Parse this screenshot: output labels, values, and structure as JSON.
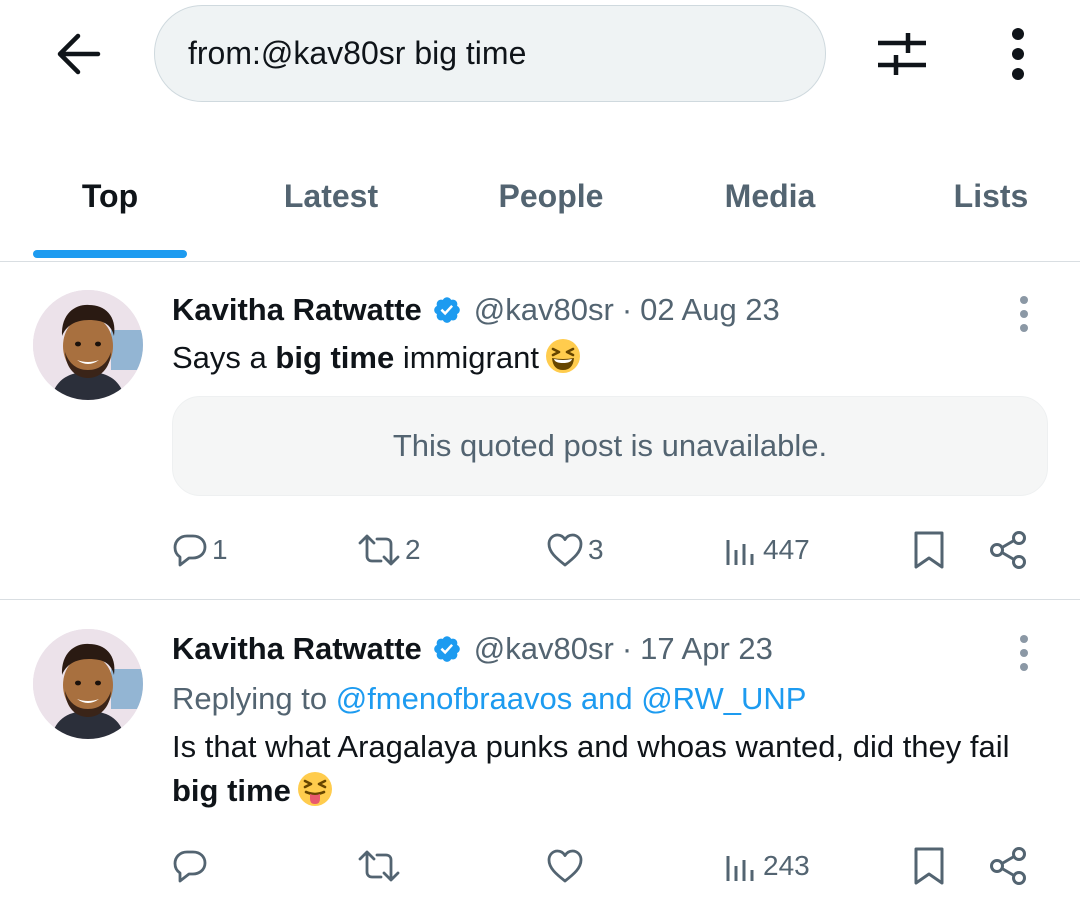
{
  "search": {
    "query": "from:@kav80sr big time"
  },
  "tabs": [
    {
      "label": "Top",
      "active": true
    },
    {
      "label": "Latest",
      "active": false
    },
    {
      "label": "People",
      "active": false
    },
    {
      "label": "Media",
      "active": false
    },
    {
      "label": "Lists",
      "active": false
    }
  ],
  "icons": {
    "back": "arrow-left-icon",
    "filter": "sliders-icon",
    "more": "more-vertical-icon",
    "reply": "speech-bubble-icon",
    "repost": "repost-icon",
    "like": "heart-icon",
    "views": "bar-chart-icon",
    "bookmark": "bookmark-icon",
    "share": "share-icon"
  },
  "colors": {
    "accent": "#1d9bf0",
    "muted": "#536471",
    "text": "#0f1419"
  },
  "posts": [
    {
      "display_name": "Kavitha Ratwatte",
      "handle": "@kav80sr",
      "separator": "·",
      "date": "02 Aug 23",
      "text_before": "Says a ",
      "text_bold": "big time",
      "text_after": " immigrant",
      "emoji": "grinning-squinting-face",
      "quoted": "This quoted post is unavailable.",
      "stats": {
        "replies": "1",
        "reposts": "2",
        "likes": "3",
        "views": "447"
      }
    },
    {
      "display_name": "Kavitha Ratwatte",
      "handle": "@kav80sr",
      "separator": "·",
      "date": "17 Apr 23",
      "replying_label": "Replying to ",
      "replying_to_1": "@fmenofbraavos",
      "replying_and": " and ",
      "replying_to_2": "@RW_UNP",
      "text_before": "Is that what Aragalaya punks and whoas wanted, did they fail ",
      "text_bold": "big time",
      "emoji": "squinting-face-with-tongue",
      "stats": {
        "replies": "",
        "reposts": "",
        "likes": "",
        "views": "243"
      }
    }
  ]
}
